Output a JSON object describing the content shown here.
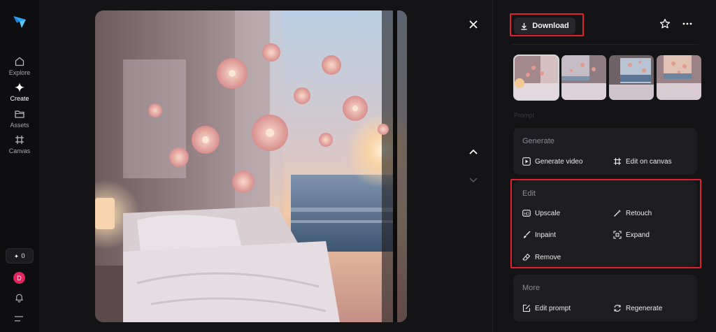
{
  "nav": {
    "items": [
      {
        "label": "Explore",
        "icon": "home-icon"
      },
      {
        "label": "Create",
        "icon": "sparkle-icon"
      },
      {
        "label": "Assets",
        "icon": "folder-icon"
      },
      {
        "label": "Canvas",
        "icon": "frame-icon"
      }
    ],
    "credits": "0",
    "avatar_initial": "D"
  },
  "panel": {
    "download_label": "Download",
    "faded_label": "Prompt",
    "generate": {
      "title": "Generate",
      "actions": [
        "Generate video",
        "Edit on canvas"
      ]
    },
    "edit": {
      "title": "Edit",
      "actions": [
        "Upscale",
        "Retouch",
        "Inpaint",
        "Expand",
        "Remove"
      ]
    },
    "more": {
      "title": "More",
      "actions": [
        "Edit prompt",
        "Regenerate"
      ]
    }
  },
  "colors": {
    "accent_red": "#e0202a",
    "avatar": "#e0255f",
    "card_bg": "#1e1e22"
  }
}
